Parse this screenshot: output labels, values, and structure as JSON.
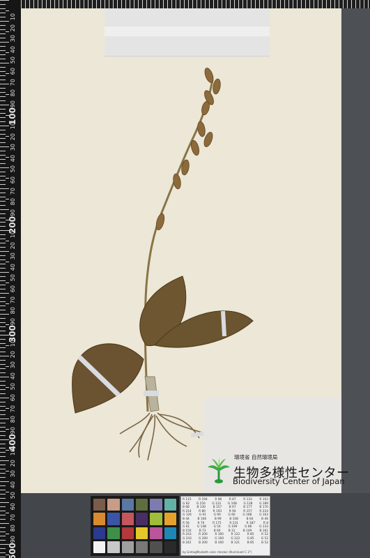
{
  "ruler": {
    "big_labels": [
      "100",
      "200",
      "300",
      "400",
      "500"
    ],
    "small_labels": [
      "10",
      "20",
      "30",
      "40",
      "50",
      "60",
      "70",
      "80",
      "90"
    ]
  },
  "specimen_label": {
    "ministry": "環境省 自然環境局",
    "org_japanese": "生物多様性センター",
    "org_english": "Biodiversity Center of Japan",
    "logo_icon": "green-plant-logo-icon"
  },
  "color_checker": {
    "patches": [
      "#7a5c4b",
      "#c89c86",
      "#5b78a3",
      "#5f6e3f",
      "#7d7bb0",
      "#62b1a7",
      "#d98a2e",
      "#3b55a6",
      "#c4565e",
      "#4a2e63",
      "#9fbc3a",
      "#e5a22b",
      "#2a3b8f",
      "#3e8f48",
      "#b23a3a",
      "#e6c72a",
      "#bb5599",
      "#1e88b5",
      "#f2f2f2",
      "#c8c8c8",
      "#a0a0a0",
      "#787878",
      "#505050",
      "#2a2a2a"
    ],
    "table_rows": [
      [
        "R 115",
        "R 194",
        "R 98",
        "R 87",
        "R 133",
        "R 103"
      ],
      [
        "G 82",
        "G 150",
        "G 122",
        "G 108",
        "G 128",
        "G 189"
      ],
      [
        "B 68",
        "B 130",
        "B 157",
        "B 67",
        "B 177",
        "B 170"
      ],
      [
        "R 214",
        "R 80",
        "R 193",
        "R 94",
        "R 157",
        "R 224"
      ],
      [
        "G 126",
        "G 91",
        "G 90",
        "G 60",
        "G 188",
        "G 163"
      ],
      [
        "B 44",
        "B 166",
        "B 99",
        "B 108",
        "B 64",
        "B 46"
      ],
      [
        "R 56",
        "R 70",
        "R 175",
        "R 231",
        "R 187",
        "R 8"
      ],
      [
        "G 61",
        "G 148",
        "G 54",
        "G 199",
        "G 86",
        "G 133"
      ],
      [
        "B 150",
        "B 73",
        "B 60",
        "B 31",
        "B 149",
        "B 161"
      ],
      [
        "R 243",
        "R 200",
        "R 160",
        "R 122",
        "R 85",
        "R 52"
      ],
      [
        "G 243",
        "G 200",
        "G 160",
        "G 122",
        "G 85",
        "G 52"
      ],
      [
        "B 242",
        "B 200",
        "B 160",
        "B 121",
        "B 85",
        "B 52"
      ]
    ],
    "caption": "by GretagMacbeth color checker (Illuminant C 2°)"
  }
}
